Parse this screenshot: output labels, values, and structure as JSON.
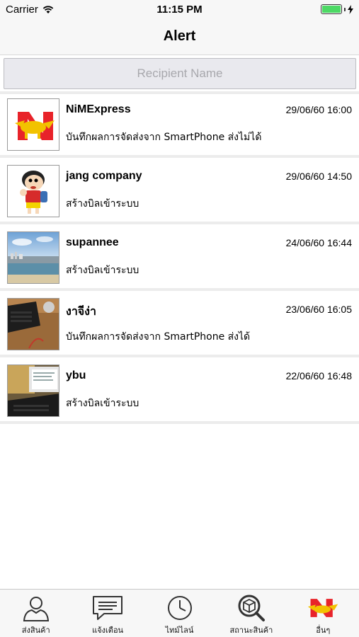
{
  "status": {
    "carrier": "Carrier",
    "time": "11:15 PM"
  },
  "nav": {
    "title": "Alert"
  },
  "search": {
    "placeholder": "Recipient Name"
  },
  "alerts": [
    {
      "name": "NiMExpress",
      "date": "29/06/60 16:00",
      "message": "บันทึกผลการจัดส่งจาก SmartPhone ส่งไม่ได้",
      "thumb": "nim-logo"
    },
    {
      "name": "jang company",
      "date": "29/06/60 14:50",
      "message": "สร้างบิลเข้าระบบ",
      "thumb": "cartoon-boy"
    },
    {
      "name": "supannee",
      "date": "24/06/60 16:44",
      "message": "สร้างบิลเข้าระบบ",
      "thumb": "beach-photo"
    },
    {
      "name": "งาจีง่า",
      "date": "23/06/60 16:05",
      "message": "บันทึกผลการจัดส่งจาก SmartPhone ส่งได้",
      "thumb": "laptop-photo"
    },
    {
      "name": "ybu",
      "date": "22/06/60 16:48",
      "message": "สร้างบิลเข้าระบบ",
      "thumb": "desk-photo"
    }
  ],
  "tabs": [
    {
      "label": "ส่งสินค้า",
      "icon": "person-icon"
    },
    {
      "label": "แจ้งเตือน",
      "icon": "message-icon"
    },
    {
      "label": "ไทม์ไลน์",
      "icon": "clock-icon"
    },
    {
      "label": "สถานะสินค้า",
      "icon": "package-search-icon"
    },
    {
      "label": "อื่นๆ",
      "icon": "nim-logo-icon"
    }
  ],
  "colors": {
    "brand_red": "#e8232a",
    "brand_yellow": "#f2c200",
    "battery_green": "#4cd964"
  }
}
